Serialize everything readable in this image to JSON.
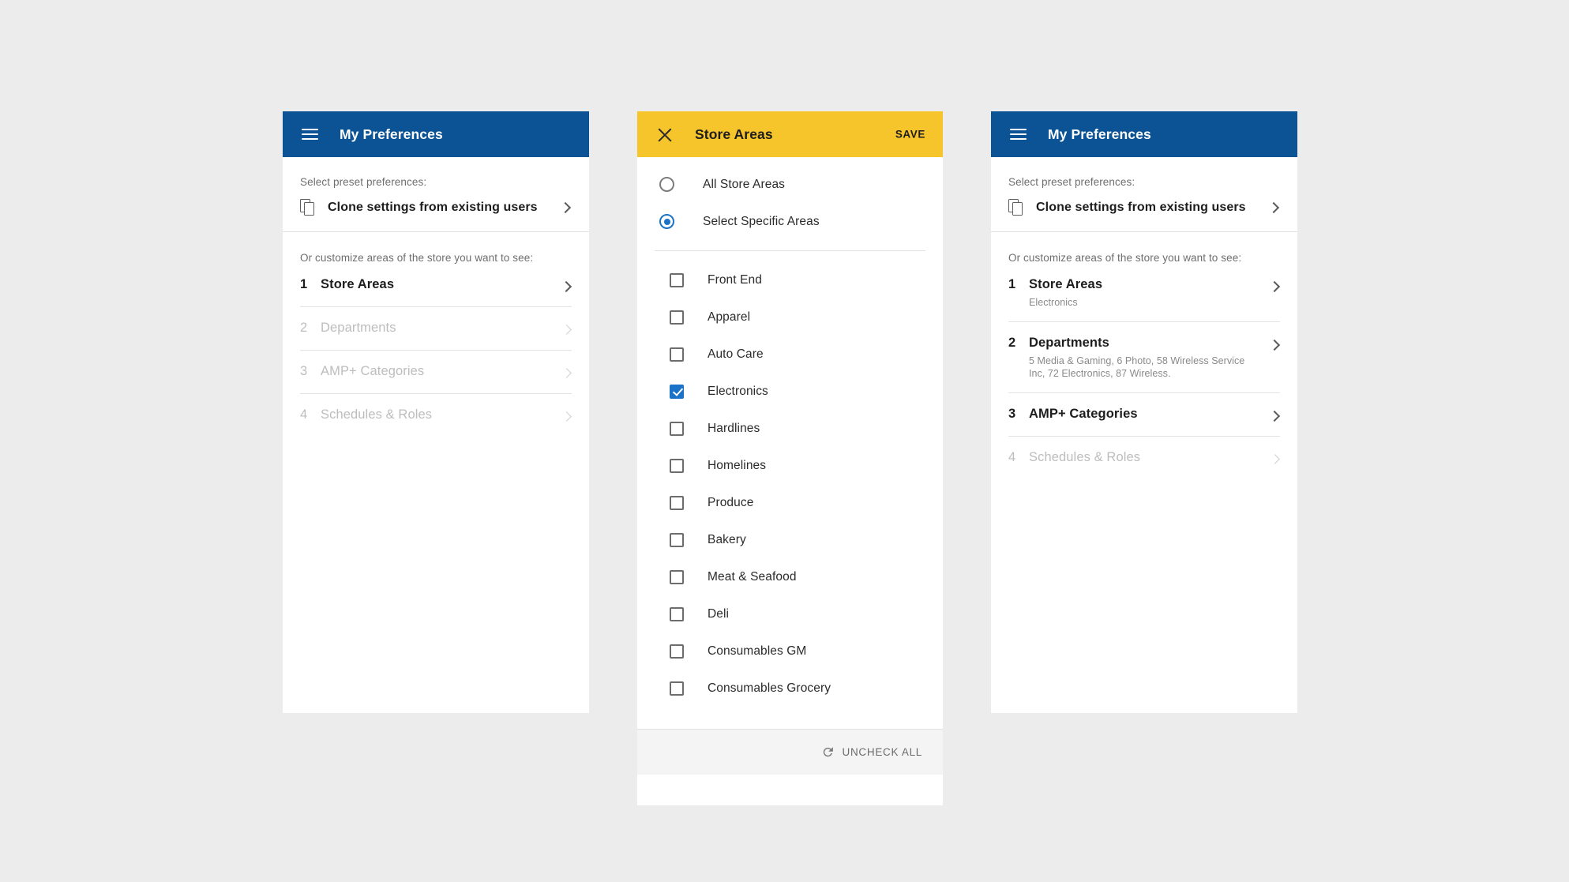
{
  "colors": {
    "appbar_blue": "#0b5394",
    "appbar_yellow": "#f6c42b",
    "accent_blue": "#1a73c8",
    "page_background": "#ececec",
    "disabled_text": "#bdbdbd"
  },
  "panel_left": {
    "appbar": {
      "menu_icon": "hamburger-icon",
      "title": "My Preferences"
    },
    "preset_label": "Select preset preferences:",
    "clone_row": {
      "icon": "copy-icon",
      "label": "Clone settings from existing users",
      "chevron": "chevron-right-icon"
    },
    "customize_label": "Or customize areas of the store you want to see:",
    "steps": [
      {
        "num": "1",
        "title": "Store Areas",
        "sub": "",
        "disabled": false
      },
      {
        "num": "2",
        "title": "Departments",
        "sub": "",
        "disabled": true
      },
      {
        "num": "3",
        "title": "AMP+ Categories",
        "sub": "",
        "disabled": true
      },
      {
        "num": "4",
        "title": "Schedules & Roles",
        "sub": "",
        "disabled": true
      }
    ]
  },
  "panel_center": {
    "appbar": {
      "close_icon": "close-icon",
      "title": "Store Areas",
      "save_label": "SAVE"
    },
    "radios": [
      {
        "label": "All Store Areas",
        "checked": false
      },
      {
        "label": "Select Specific Areas",
        "checked": true
      }
    ],
    "checkboxes": [
      {
        "label": "Front End",
        "checked": false
      },
      {
        "label": "Apparel",
        "checked": false
      },
      {
        "label": "Auto Care",
        "checked": false
      },
      {
        "label": "Electronics",
        "checked": true
      },
      {
        "label": "Hardlines",
        "checked": false
      },
      {
        "label": "Homelines",
        "checked": false
      },
      {
        "label": "Produce",
        "checked": false
      },
      {
        "label": "Bakery",
        "checked": false
      },
      {
        "label": "Meat & Seafood",
        "checked": false
      },
      {
        "label": "Deli",
        "checked": false
      },
      {
        "label": "Consumables GM",
        "checked": false
      },
      {
        "label": "Consumables Grocery",
        "checked": false
      }
    ],
    "footer": {
      "icon": "refresh-icon",
      "uncheck_all_label": "UNCHECK ALL"
    }
  },
  "panel_right": {
    "appbar": {
      "menu_icon": "hamburger-icon",
      "title": "My Preferences"
    },
    "preset_label": "Select preset preferences:",
    "clone_row": {
      "icon": "copy-icon",
      "label": "Clone settings from existing users",
      "chevron": "chevron-right-icon"
    },
    "customize_label": "Or customize areas of the store you want to see:",
    "steps": [
      {
        "num": "1",
        "title": "Store Areas",
        "sub": "Electronics",
        "disabled": false
      },
      {
        "num": "2",
        "title": "Departments",
        "sub": "5 Media & Gaming,  6 Photo,  58 Wireless Service Inc, 72 Electronics,  87 Wireless.",
        "disabled": false
      },
      {
        "num": "3",
        "title": "AMP+ Categories",
        "sub": "",
        "disabled": false
      },
      {
        "num": "4",
        "title": "Schedules & Roles",
        "sub": "",
        "disabled": true
      }
    ]
  }
}
